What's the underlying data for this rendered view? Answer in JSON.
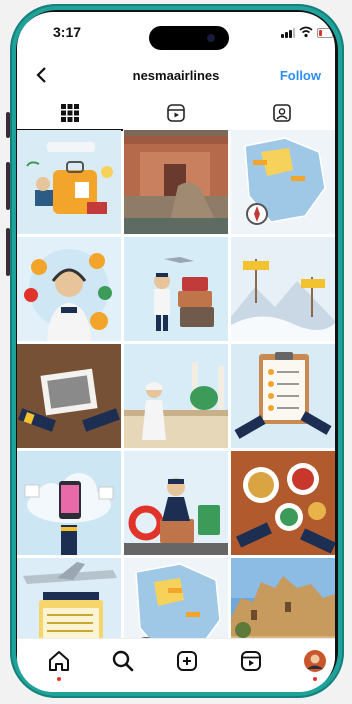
{
  "status": {
    "time": "3:17"
  },
  "profile": {
    "username": "nesmaairlines",
    "follow_label": "Follow"
  },
  "tabs": [
    {
      "name": "posts-grid",
      "active": true
    },
    {
      "name": "reels",
      "active": false
    },
    {
      "name": "tagged",
      "active": false
    }
  ],
  "posts": [
    {
      "subject": "luggage-suitcase"
    },
    {
      "subject": "egyptian-museum-sphinx"
    },
    {
      "subject": "saudi-map-compass"
    },
    {
      "subject": "pilot-call-center-24"
    },
    {
      "subject": "pilot-with-luggage"
    },
    {
      "subject": "signpost-mountains"
    },
    {
      "subject": "pilot-hand-photo"
    },
    {
      "subject": "mosque-traveler"
    },
    {
      "subject": "checklist-clipboard"
    },
    {
      "subject": "cloud-phone-gallery"
    },
    {
      "subject": "pilot-luggage-lifebuoy"
    },
    {
      "subject": "food-dishes"
    },
    {
      "subject": "airplane-flight-schedule"
    },
    {
      "subject": "saudi-map-compass-2"
    },
    {
      "subject": "mud-fort-ruins"
    }
  ],
  "nav": [
    "home-icon",
    "search-icon",
    "create-icon",
    "reels-icon",
    "profile-avatar"
  ],
  "colors": {
    "phone_frame": "#1fa29a",
    "follow": "#2f8ff0",
    "notification_dot": "#e0342b"
  }
}
